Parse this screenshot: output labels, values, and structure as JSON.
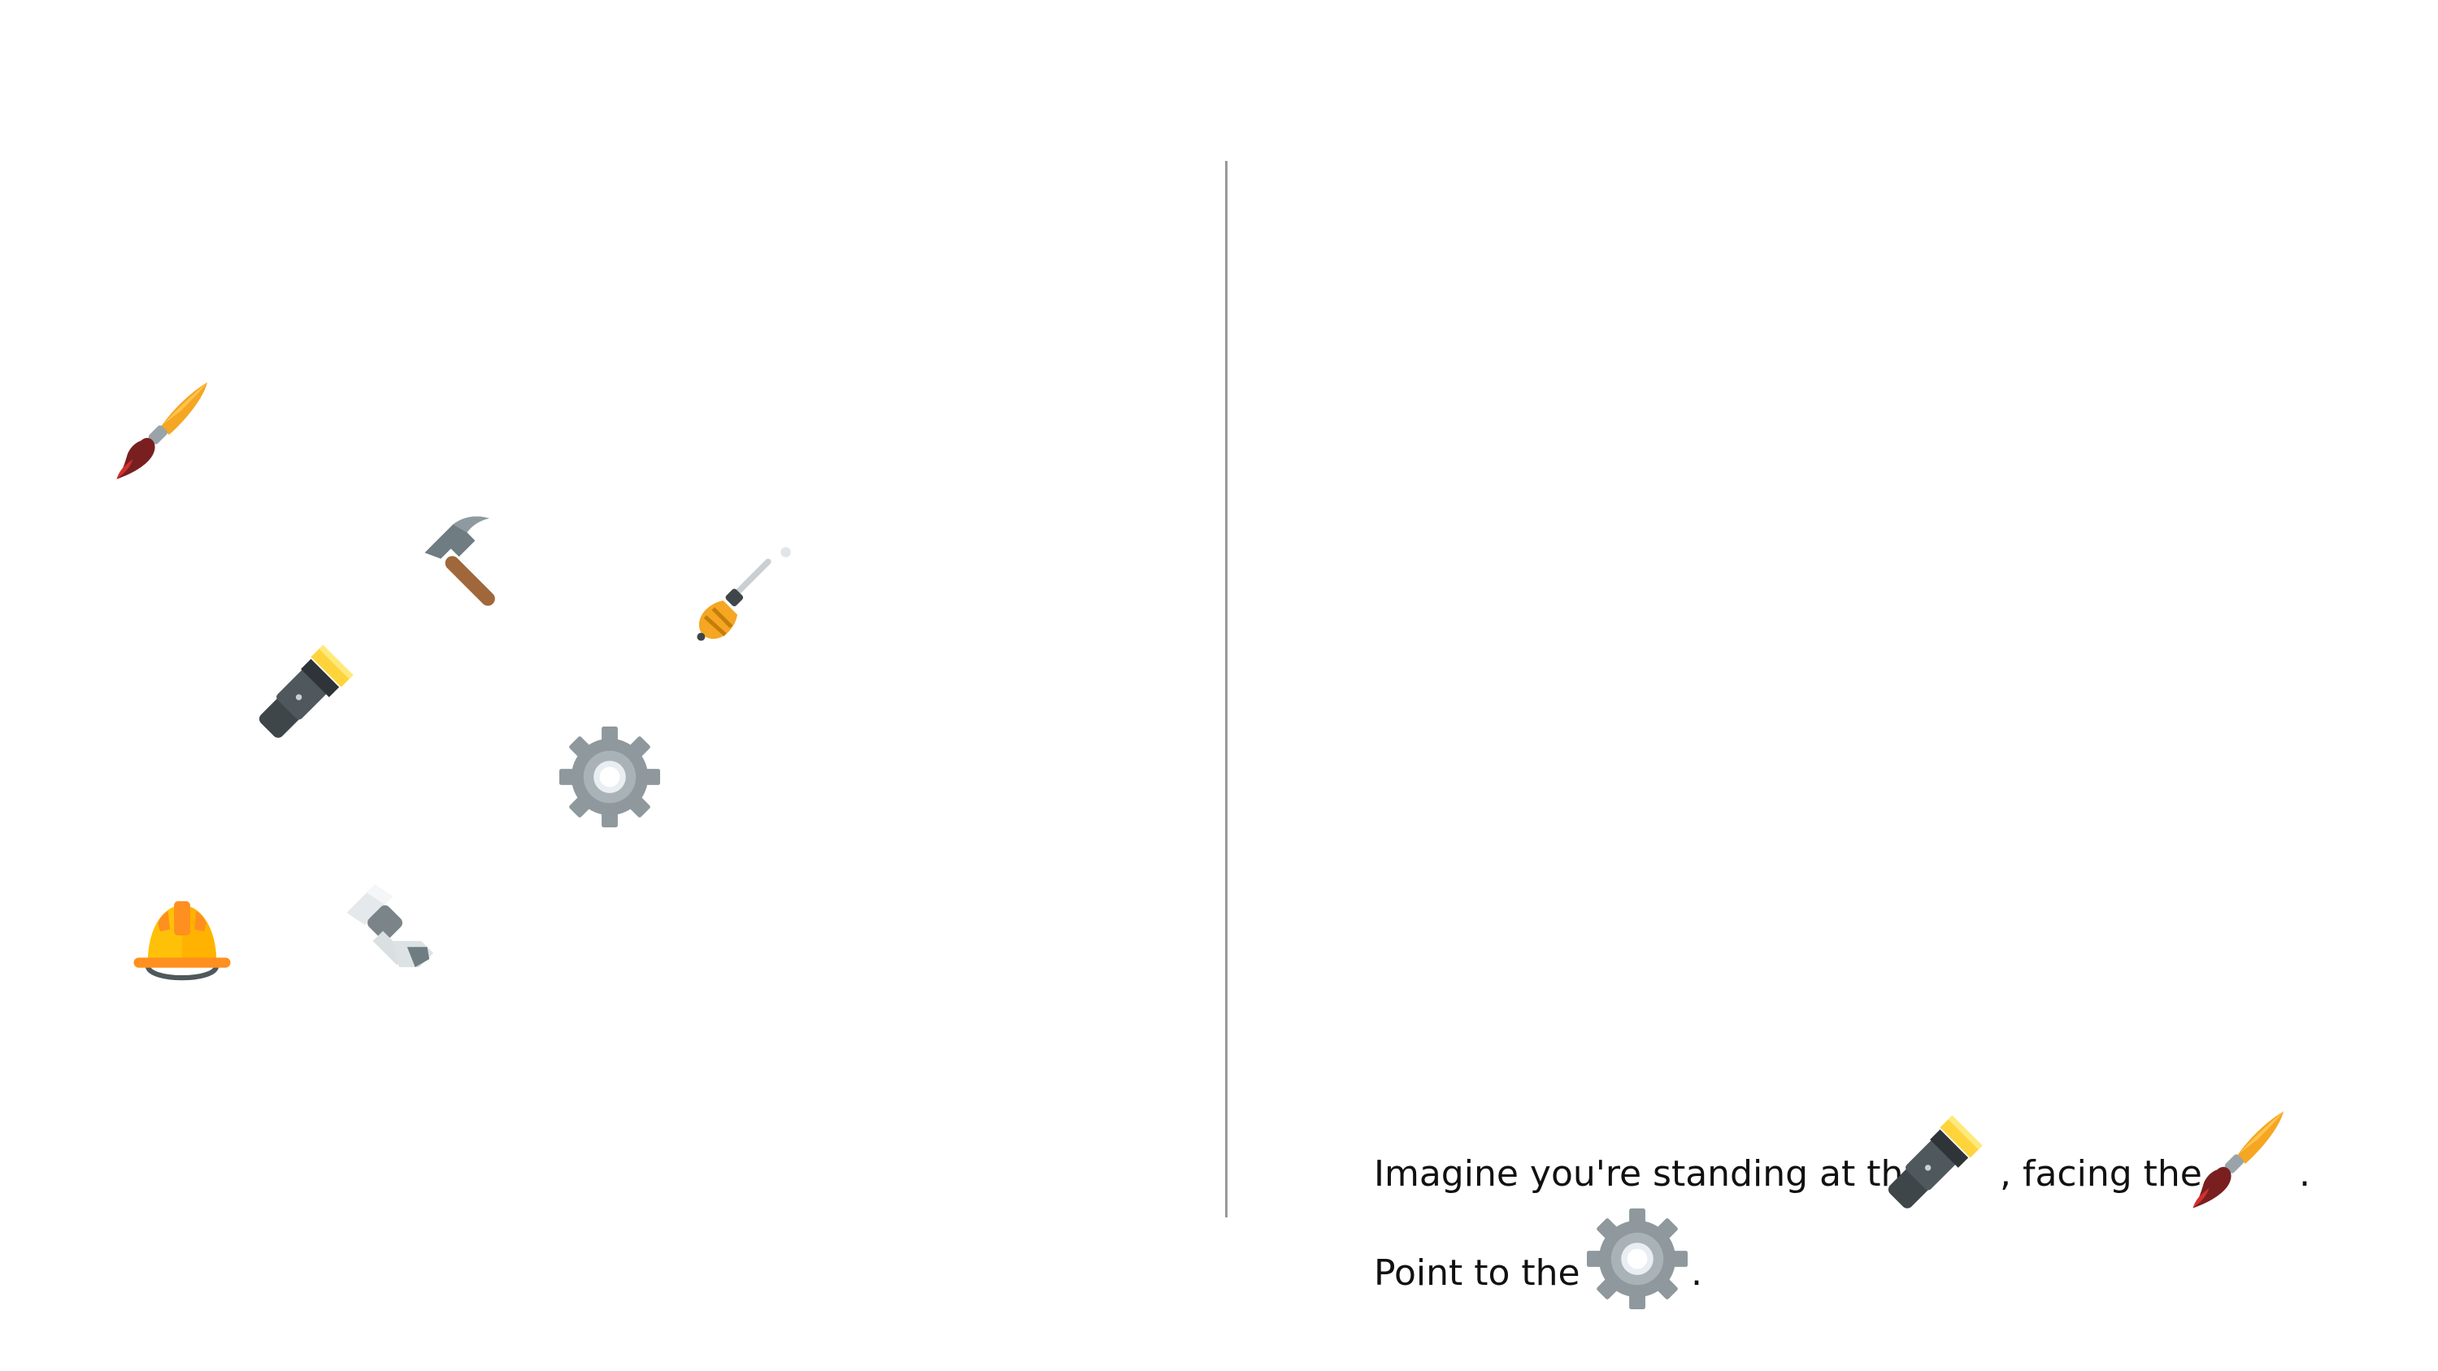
{
  "scene": {
    "items": [
      {
        "name": "paintbrush",
        "icon": "paintbrush-icon"
      },
      {
        "name": "hammer",
        "icon": "hammer-icon"
      },
      {
        "name": "screwdriver",
        "icon": "screwdriver-icon"
      },
      {
        "name": "flashlight",
        "icon": "flashlight-icon"
      },
      {
        "name": "gear",
        "icon": "gear-icon"
      },
      {
        "name": "hard-hat",
        "icon": "hard-hat-icon"
      },
      {
        "name": "bolt",
        "icon": "bolt-icon"
      }
    ]
  },
  "prompt": {
    "line1_part1": "Imagine you're standing at the",
    "line1_icon1": "flashlight-icon",
    "line1_part2": ", facing the",
    "line1_icon2": "paintbrush-icon",
    "line1_part3": ".",
    "line2_part1": "Point to the",
    "line2_icon1": "gear-icon",
    "line2_part2": "."
  },
  "colors": {
    "divider": "#999999",
    "orange": "#F5A623",
    "yellow": "#FFD43B",
    "gray": "#9AA3A8",
    "dark": "#3F4649"
  }
}
